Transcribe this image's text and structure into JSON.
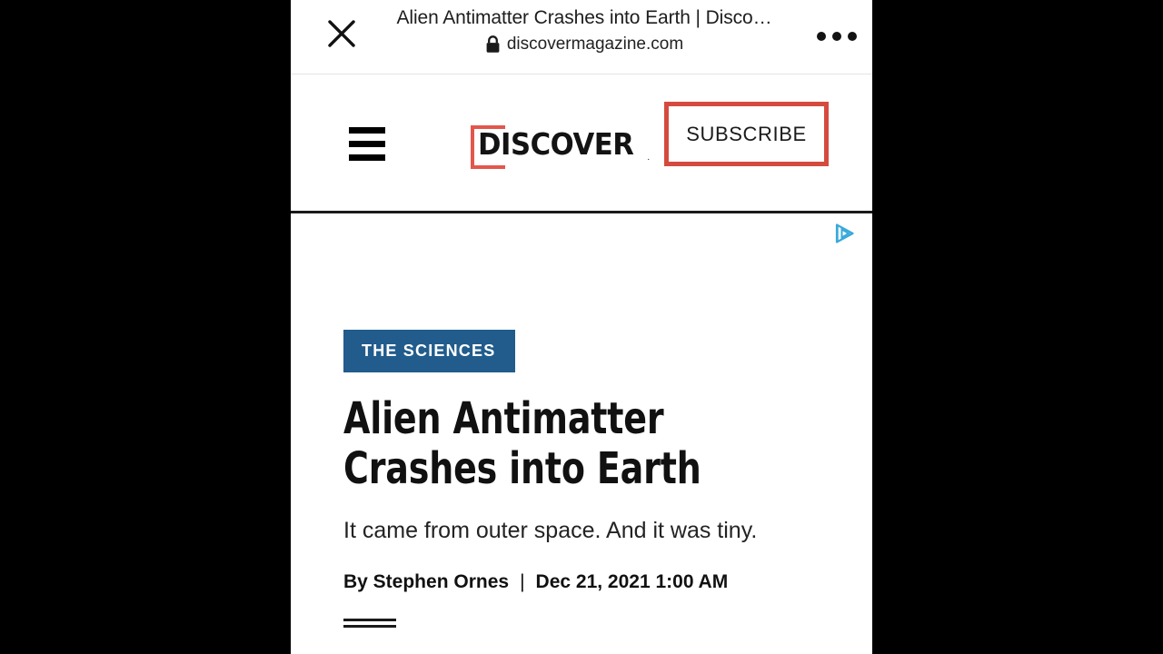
{
  "browser": {
    "close_icon": "close-x-icon",
    "tab_title": "Alien Antimatter Crashes into Earth | Disco…",
    "lock_icon": "lock-icon",
    "url": "discovermagazine.com",
    "overflow_icon": "more-horizontal-icon"
  },
  "site_header": {
    "menu_icon": "hamburger-menu-icon",
    "logo_text": "DISCOVER",
    "logo_trademark": ".",
    "subscribe_label": "SUBSCRIBE",
    "accent_red": "#d44b3e",
    "logo_bracket_red": "#e2574c"
  },
  "ad": {
    "adchoices_icon": "adchoices-icon",
    "adchoices_color": "#39a9dc"
  },
  "article": {
    "category": "THE SCIENCES",
    "category_color": "#215c8c",
    "headline": "Alien Antimatter Crashes into Earth",
    "dek": "It came from outer space. And it was tiny.",
    "author": "By Stephen Ornes",
    "byline_separator": "|",
    "date": "Dec 21, 2021 1:00 AM"
  }
}
